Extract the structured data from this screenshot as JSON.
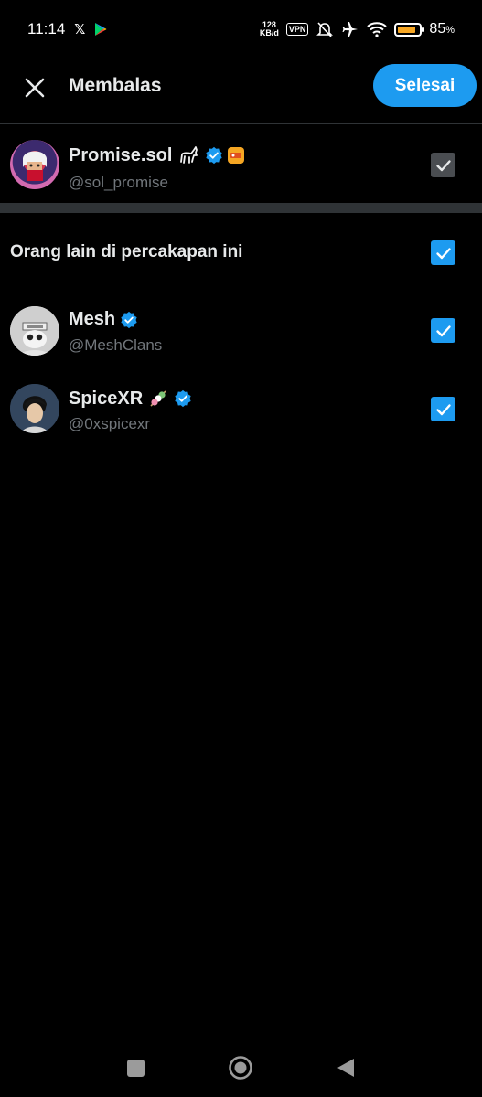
{
  "status_bar": {
    "time": "11:14",
    "net_speed_value": "128",
    "net_speed_unit": "KB/d",
    "vpn": "VPN",
    "battery_percent": "85",
    "battery_unit": "%",
    "battery_level": 0.85
  },
  "header": {
    "title": "Membalas",
    "done_label": "Selesai"
  },
  "primary_user": {
    "name": "Promise.sol",
    "handle": "@sol_promise",
    "checked": true,
    "enabled": false
  },
  "section": {
    "label": "Orang lain di percakapan ini",
    "checked": true
  },
  "others": [
    {
      "name": "Mesh",
      "handle": "@MeshClans",
      "checked": true
    },
    {
      "name": "SpiceXR",
      "handle": "@0xspicexr",
      "checked": true
    }
  ],
  "colors": {
    "accent": "#1d9bf0",
    "background": "#000000",
    "secondary_text": "#71767b",
    "disabled_checkbox": "#4a4d51"
  },
  "icons": {
    "close": "close-icon",
    "verified": "verified-badge-icon",
    "check": "check-icon"
  }
}
